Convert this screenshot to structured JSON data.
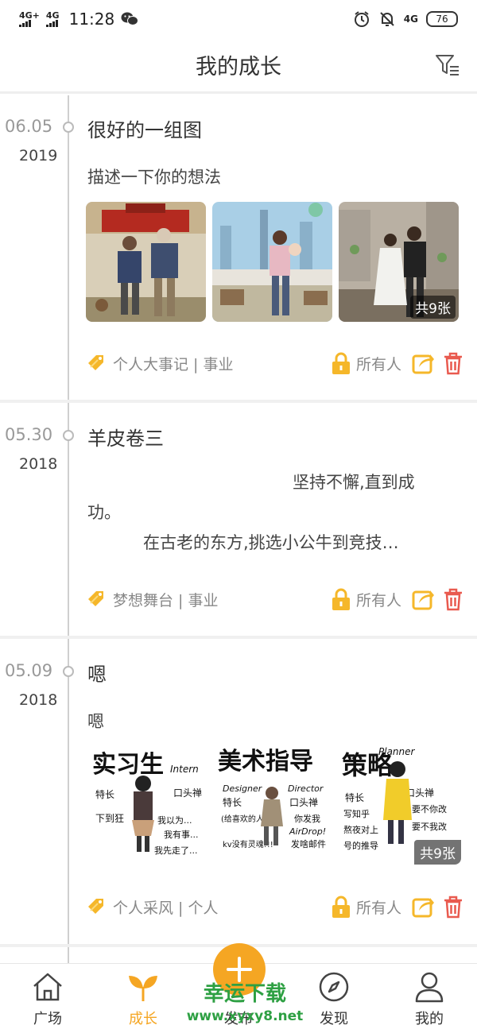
{
  "status_bar": {
    "signal1": "4G+",
    "signal2": "4G",
    "time": "11:28",
    "net_right": "4G",
    "battery": "76",
    "icons": [
      "wechat-icon",
      "alarm-icon",
      "mute-bell-icon"
    ]
  },
  "header": {
    "title": "我的成长",
    "filter_icon": "filter-icon"
  },
  "entries": [
    {
      "date": "06.05",
      "year": "2019",
      "title": "很好的一组图",
      "description": "描述一下你的想法",
      "photo_count": "共9张",
      "tags": "个人大事记 | 事业",
      "privacy": "所有人"
    },
    {
      "date": "05.30",
      "year": "2018",
      "title": "羊皮卷三",
      "description_line1": "坚持不懈,直到成",
      "description_line2": "功。",
      "description_line3": "在古老的东方,挑选小公牛到竞技…",
      "tags": "梦想舞台 | 事业",
      "privacy": "所有人"
    },
    {
      "date": "05.09",
      "year": "2018",
      "title": "嗯",
      "description": "嗯",
      "photo_count": "共9张",
      "tags": "个人采风 | 个人",
      "privacy": "所有人",
      "banner_texts": {
        "p1_title": "实习生",
        "p1_sub": "Intern",
        "p1_a": "特长",
        "p1_b": "口头禅",
        "p1_c": "下到狂",
        "p1_d": "我以为...",
        "p1_e": "我有事...",
        "p1_f": "我先走了...",
        "p2_title": "美术指导",
        "p2_sub1": "Designer",
        "p2_sub2": "Director",
        "p2_a": "特长",
        "p2_b": "口头禅",
        "p2_c": "(给喜欢的人)",
        "p2_d": "你发我",
        "p2_e": "AirDrop!",
        "p2_f": "发啥邮件",
        "p2_g": "kv没有灵魂!!!",
        "p3_title": "策略",
        "p3_sub": "Planner",
        "p3_a": "特长",
        "p3_b": "口头禅",
        "p3_c": "写知乎",
        "p3_d": "要不你改",
        "p3_e": "熬夜对上",
        "p3_f": "要不我改",
        "p3_g": "号的推导"
      }
    }
  ],
  "nav": {
    "items": [
      {
        "label": "广场",
        "icon": "home-icon"
      },
      {
        "label": "成长",
        "icon": "sprout-icon"
      },
      {
        "label": "发布",
        "icon": "plus-icon"
      },
      {
        "label": "发现",
        "icon": "compass-icon"
      },
      {
        "label": "我的",
        "icon": "person-icon"
      }
    ]
  },
  "watermark": {
    "line1": "幸运下载",
    "line2": "www.xyxy8.net"
  },
  "colors": {
    "accent": "#f5a623",
    "trash": "#e95a4f",
    "line": "#cfcfcf"
  }
}
